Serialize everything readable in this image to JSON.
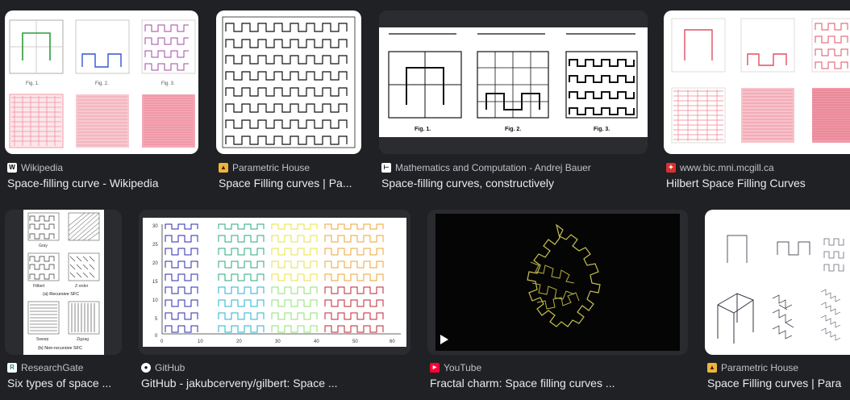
{
  "results": [
    {
      "source": "Wikipedia",
      "title": "Space-filling curve - Wikipedia",
      "favicon": "wikipedia-icon"
    },
    {
      "source": "Parametric House",
      "title": "Space Filling curves | Pa...",
      "favicon": "parametric-house-icon"
    },
    {
      "source": "Mathematics and Computation - Andrej Bauer",
      "title": "Space-filling curves, constructively",
      "favicon": "math-computation-icon"
    },
    {
      "source": "www.bic.mni.mcgill.ca",
      "title": "Hilbert Space Filling Curves",
      "favicon": "mcgill-icon"
    },
    {
      "source": "ResearchGate",
      "title": "Six types of space ...",
      "favicon": "researchgate-icon"
    },
    {
      "source": "GitHub",
      "title": "GitHub - jakubcerveny/gilbert: Space ...",
      "favicon": "github-icon"
    },
    {
      "source": "YouTube",
      "title": "Fractal charm: Space filling curves ...",
      "favicon": "youtube-icon"
    },
    {
      "source": "Parametric House",
      "title": "Space Filling curves | Para",
      "favicon": "parametric-house-icon"
    }
  ],
  "thumb_text": {
    "wiki_figs": [
      "Fig. 1.",
      "Fig. 2.",
      "Fig. 3."
    ],
    "bauer_figs": [
      "Fig. 1.",
      "Fig. 2.",
      "Fig. 3."
    ],
    "rg_labels": [
      "Gray",
      "Hilbert",
      "Z-order",
      "(a) Recursive SFC",
      "Sweep",
      "Zigzag",
      "(b) Non-recursive SFC"
    ],
    "gilbert_yticks": [
      "30",
      "25",
      "20",
      "15",
      "10",
      "5",
      "0"
    ],
    "gilbert_xticks": [
      "0",
      "10",
      "20",
      "30",
      "40",
      "50",
      "60"
    ]
  },
  "colors": {
    "background": "#202124",
    "title": "#e8eaed",
    "source": "#bdc1c6"
  }
}
